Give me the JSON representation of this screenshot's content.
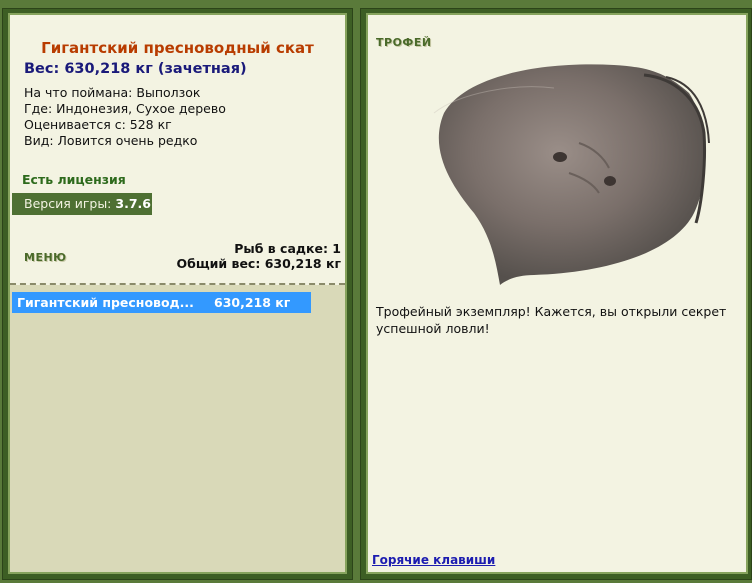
{
  "fish": {
    "title": "Гигантский пресноводный скат",
    "weight": "Вес: 630,218 кг (зачетная)",
    "bait": "На что поймана: Выползок",
    "location": "Где: Индонезия, Сухое дерево",
    "value": "Оценивается с: 528 кг",
    "rarity": "Вид: Ловится очень редко"
  },
  "license": "Есть лицензия",
  "version": {
    "label": "Версия игры:",
    "value": "3.7.6"
  },
  "menu_label": "МЕНЮ",
  "keepnet": {
    "count": "Рыб в садке: 1",
    "total": "Общий вес: 630,218 кг"
  },
  "catch_list": [
    {
      "name": "Гигантский пресновод...",
      "weight": "630,218 кг"
    }
  ],
  "trophy": {
    "label": "ТРОФЕЙ",
    "text": "Трофейный экземпляр! Кажется, вы открыли секрет успешной ловли!"
  },
  "hotkeys_link": "Горячие клавиши",
  "colors": {
    "title": "#b83c00",
    "weight": "#1a1a7a",
    "license": "#2d6a1c",
    "selection": "#3399ff",
    "link": "#1c1cb0"
  }
}
